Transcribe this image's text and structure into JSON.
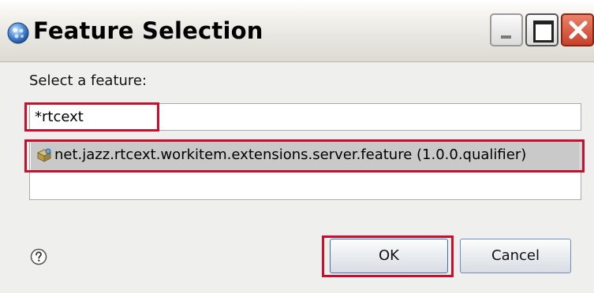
{
  "window": {
    "title": "Feature Selection"
  },
  "dialog": {
    "prompt": "Select a feature:",
    "filter_value": "*rtcext",
    "features": [
      {
        "label": "net.jazz.rtcext.workitem.extensions.server.feature (1.0.0.qualifier)",
        "selected": true
      }
    ]
  },
  "buttons": {
    "ok_label": "OK",
    "cancel_label": "Cancel"
  },
  "colors": {
    "highlight_box": "#c8102e",
    "selection_bg": "#c9c9c9",
    "close_button": "#d0503a"
  },
  "icons": {
    "title": "eclipse-globe-icon",
    "feature": "plugin-feature-icon",
    "help": "help-icon"
  }
}
